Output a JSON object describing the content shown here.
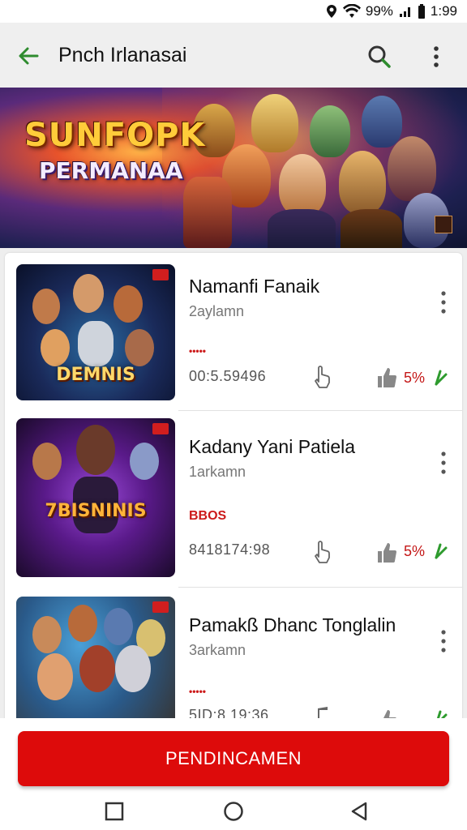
{
  "status": {
    "battery": "99%",
    "time": "1:99"
  },
  "app_bar": {
    "title": "Pnch Irlanasai"
  },
  "banner": {
    "title_line1": "SUNFOPK",
    "title_line2": "PERMANAA"
  },
  "items": [
    {
      "name": "Namanfi Fanaik",
      "sub": "2aylamn",
      "tag": "•••••",
      "code": "00:5.59496",
      "percent": "5%",
      "caption": "DEMNIS"
    },
    {
      "name": "Kadany Yani Patiela",
      "sub": "1arkamn",
      "tag": "BBOS",
      "code": "8418174:98",
      "percent": "5%",
      "caption": "7BISNINIS"
    },
    {
      "name": "Pamakß Dhanc Tonglalin",
      "sub": "3arkamn",
      "tag": "•••••",
      "code": "5ID:8.19:36",
      "percent": "",
      "caption": ""
    }
  ],
  "cta": {
    "label": "PENDINCAMEN"
  },
  "colors": {
    "accent": "#dd0b0b",
    "back_arrow": "#2e8b2e",
    "percent": "#c41717"
  }
}
